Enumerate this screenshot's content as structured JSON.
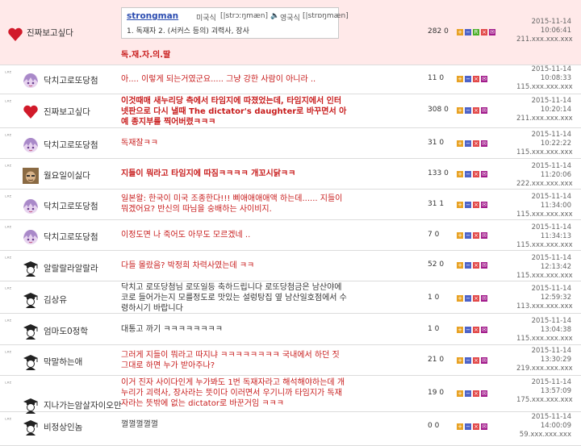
{
  "colors": {
    "accent_red": "#c81c1c",
    "highlight_row": "#ffe9e9",
    "btn_orange": "#e8a224",
    "btn_blue": "#4d63c8",
    "btn_green": "#4caf2a",
    "btn_red": "#e24a4a",
    "btn_purple": "#a21b8b"
  },
  "reply_badge": "ᴸᴿᴱ",
  "dictionary": {
    "word": "strongman",
    "us_label": "미국식",
    "us_pron": "[|strɔːŋmæn]",
    "uk_label": "영국식",
    "uk_pron": "[|strɒŋmæn]",
    "definition": "1. 독재자   2. (서커스 등의) 괴력사, 장사",
    "speaker_icon": "speaker-icon"
  },
  "comments": [
    {
      "avatar": "heart-icon",
      "reply": false,
      "nick": "진짜보고싶다",
      "text": "독.재.자.의.딸",
      "recommend": "282",
      "oppose": "0",
      "green_button": true,
      "date": "2015-11-14",
      "time": "10:06:41",
      "ip": "211.xxx.xxx.xxx"
    },
    {
      "avatar": "anime-girl-icon",
      "reply": true,
      "nick": "닥치고로또당첨",
      "text": "아.... 이렇게 되는거였군요..... 그냥 강한 사람이 아니라 ..",
      "recommend": "11",
      "oppose": "0",
      "date": "2015-11-14",
      "time": "10:08:33",
      "ip": "115.xxx.xxx.xxx"
    },
    {
      "avatar": "heart-icon",
      "reply": true,
      "nick": "진짜보고싶다",
      "text": "이것때매 새누리당 측에서 타임지에 따졌었는데, 타임지에서 인터넷판으로 다시 낼때 The dictator's daughter로 바꾸면서 아예 종지부를 찍어버렸ㅋㅋㅋ",
      "recommend": "308",
      "oppose": "0",
      "date": "2015-11-14",
      "time": "10:20:14",
      "ip": "211.xxx.xxx.xxx"
    },
    {
      "avatar": "anime-girl-icon",
      "reply": true,
      "nick": "닥치고로또당첨",
      "text": "독재잘ㅋㅋ",
      "recommend": "31",
      "oppose": "0",
      "date": "2015-11-14",
      "time": "10:22:22",
      "ip": "115.xxx.xxx.xxx"
    },
    {
      "avatar": "face-photo-icon",
      "reply": true,
      "nick": "월요일이싫다",
      "text": "지들이 뭐라고 타임지에 따짐ㅋㅋㅋㅋ 개꼬시닭ㅋㅋ",
      "recommend": "133",
      "oppose": "0",
      "date": "2015-11-14",
      "time": "11:20:06",
      "ip": "222.xxx.xxx.xxx"
    },
    {
      "avatar": "anime-girl-icon",
      "reply": true,
      "nick": "닥치고로또당첨",
      "text": "일본왈: 한국이 미국 조종한다!!! 삐애애애애액 하는데...... 지들이 뭐겠어요? 반신의 따님을 숭배하는 사이비지.",
      "recommend": "31",
      "oppose": "1",
      "date": "2015-11-14",
      "time": "11:34:00",
      "ip": "115.xxx.xxx.xxx"
    },
    {
      "avatar": "anime-girl-icon",
      "reply": true,
      "nick": "닥치고로또당첨",
      "text": "이정도면 나 죽어도 아무도 모르겠네 ..",
      "recommend": "7",
      "oppose": "0",
      "date": "2015-11-14",
      "time": "11:34:13",
      "ip": "115.xxx.xxx.xxx"
    },
    {
      "avatar": "graduate-icon",
      "reply": true,
      "nick": "알랄랄라알랄라",
      "text": "다들 몰랐음? 박정희 차력사였는데 ㅋㅋ",
      "recommend": "52",
      "oppose": "0",
      "date": "2015-11-14",
      "time": "12:13:42",
      "ip": "115.xxx.xxx.xxx"
    },
    {
      "avatar": "graduate-icon",
      "reply": true,
      "nick": "김상유",
      "text": "닥치고 로또당첨님 로또일등 축하드립니다 로또당첨금은 남산야에 코로 들어가는지 모를정도로 맛있는 설렁탕집 옆 남산일호점에서 수령하시기 바랍니다",
      "recommend": "1",
      "oppose": "0",
      "dark": true,
      "date": "2015-11-14",
      "time": "12:59:32",
      "ip": "113.xxx.xxx.xxx"
    },
    {
      "avatar": "graduate-icon",
      "reply": true,
      "nick": "엄마도0정학",
      "text": "대통고 까기 ㅋㅋㅋㅋㅋㅋㅋㅋ",
      "recommend": "1",
      "oppose": "0",
      "dark": true,
      "date": "2015-11-14",
      "time": "13:04:38",
      "ip": "115.xxx.xxx.xxx"
    },
    {
      "avatar": "graduate-icon",
      "reply": true,
      "nick": "막말하는애",
      "text": "그러게 지들이 뭐라고 따지냐 ㅋㅋㅋㅋㅋㅋㅋㅋ 국내에서 하던 짓 그대로 하면 누가 받아주나?",
      "recommend": "21",
      "oppose": "0",
      "date": "2015-11-14",
      "time": "13:30:29",
      "ip": "219.xxx.xxx.xxx"
    },
    {
      "avatar": "graduate-icon",
      "reply": true,
      "nick": "지나가는암살자이오만",
      "text": "이거 진자 사이다인게 누가봐도 1번 독재자라고 해석해야하는데 개누리가 괴력사, 장사라는 뜻이다 이러면서 우기니까 타임지가 독재자라는 뜻밖에 없는 dictator로 바꾼거임 ㅋㅋㅋ",
      "recommend": "19",
      "oppose": "0",
      "date": "2015-11-14",
      "time": "13:57:09",
      "ip": "175.xxx.xxx.xxx"
    },
    {
      "avatar": "graduate-icon",
      "reply": true,
      "nick": "비정상인놈",
      "text": "껄껄껄껄껄",
      "recommend": "0",
      "oppose": "0",
      "dark": true,
      "date": "2015-11-14",
      "time": "14:00:09",
      "ip": "59.xxx.xxx.xxx"
    }
  ]
}
